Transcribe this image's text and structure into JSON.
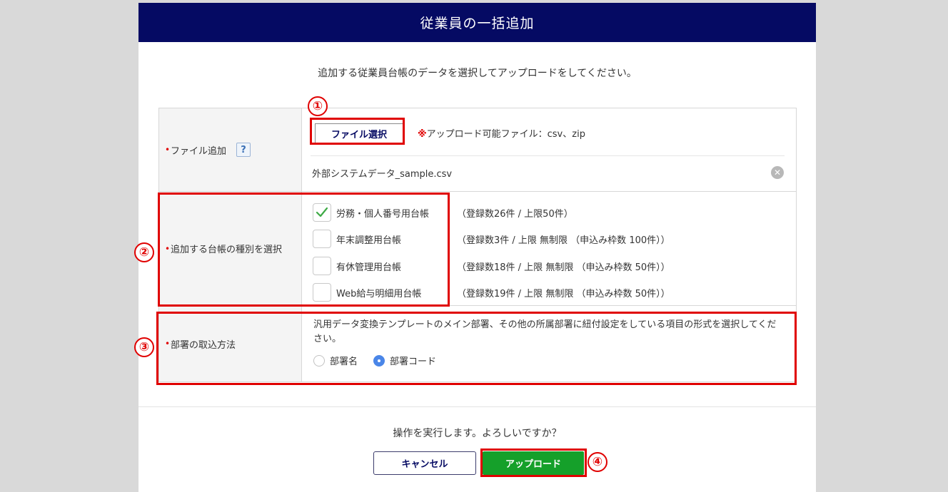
{
  "dialog": {
    "title": "従業員の一括追加",
    "intro": "追加する従業員台帳のデータを選択してアップロードをしてください。"
  },
  "file_row": {
    "label": "ファイル追加",
    "help": "?",
    "button": "ファイル選択",
    "note_mark": "※",
    "note": "アップロード可能ファイル：csv、zip",
    "file_name": "外部システムデータ_sample.csv",
    "clear": "✕"
  },
  "ledger_row": {
    "label": "追加する台帳の種別を選択",
    "items": [
      {
        "label": "労務・個人番号用台帳",
        "count": "（登録数26件 / 上限50件）",
        "checked": true
      },
      {
        "label": "年末調整用台帳",
        "count": "（登録数3件 / 上限 無制限 （申込み枠数 100件））",
        "checked": false
      },
      {
        "label": "有休管理用台帳",
        "count": "（登録数18件 / 上限 無制限 （申込み枠数 50件））",
        "checked": false
      },
      {
        "label": "Web給与明細用台帳",
        "count": "（登録数19件 / 上限 無制限 （申込み枠数 50件））",
        "checked": false
      }
    ]
  },
  "dept_row": {
    "label": "部署の取込方法",
    "description": "汎用データ変換テンプレートのメイン部署、その他の所属部署に紐付設定をしている項目の形式を選択してください。",
    "options": [
      {
        "label": "部署名",
        "selected": false
      },
      {
        "label": "部署コード",
        "selected": true
      }
    ]
  },
  "required_mark": "•",
  "footer": {
    "confirm": "操作を実行します。よろしいですか？",
    "cancel": "キャンセル",
    "upload": "アップロード"
  },
  "annotations": [
    "①",
    "②",
    "③",
    "④"
  ],
  "colors": {
    "header": "#050a63",
    "upload": "#15a02a",
    "callout": "#e00000",
    "radio_selected": "#4a86e8"
  }
}
